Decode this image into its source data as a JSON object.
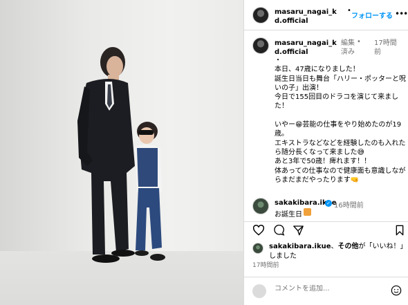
{
  "header": {
    "username": "masaru_nagai_kd.official",
    "separator": "•",
    "follow_label": "フォローする",
    "more_icon": "more-horizontal-icon"
  },
  "caption": {
    "username": "masaru_nagai_kd.official",
    "edited": "編集済み",
    "separator": "•",
    "time": "17時間前",
    "text": "・\n本日、47歳になりました！\n誕生日当日も舞台「ハリー・ポッターと呪いの子」出演！\n今日で155回目のドラコを演じて来ました！\n\nいやー😁芸能の仕事をやり始めたのが19歳。\nエキストラなどなどを経験したのも入れたら随分長くなって来ました😅\nあと3年で50歳！痺れます！！\n体あっての仕事なので健康面も意識しながらまだまだやったります🤜"
  },
  "comment": {
    "username": "sakakibara.ikue",
    "verified_icon": "verified-badge-icon",
    "time": "16時間前",
    "text": "お誕生日",
    "emoji_icon": "gift-emoji-icon"
  },
  "actions": {
    "like_icon": "heart-icon",
    "comment_icon": "comment-icon",
    "share_icon": "share-icon",
    "save_icon": "bookmark-icon"
  },
  "likes": {
    "user": "sakakibara.ikue",
    "others": "その他",
    "text_mid": "、",
    "text_tail": "が「いいね！」しました"
  },
  "post_time": "17時間前",
  "add_comment": {
    "placeholder": "コメントを追加...",
    "emoji_icon": "smiley-icon"
  },
  "colors": {
    "link_blue": "#0095f6",
    "muted": "#737373",
    "border": "#dbdbdb"
  }
}
